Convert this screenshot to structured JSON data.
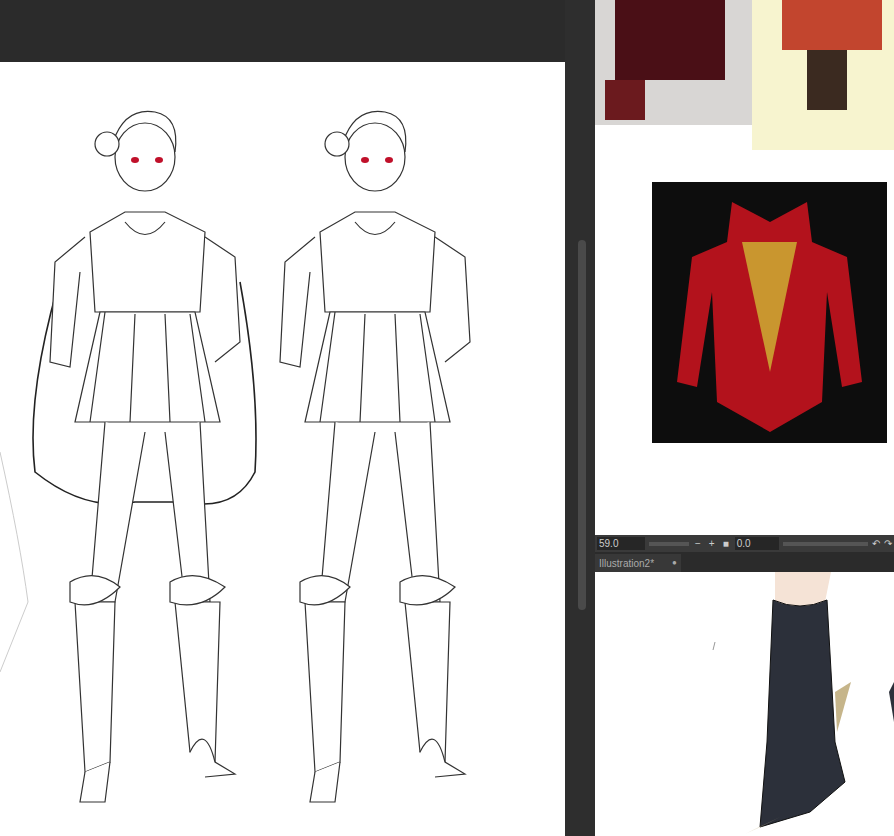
{
  "canvas": {
    "figures": [
      {
        "cape": true
      },
      {
        "cape": false
      }
    ]
  },
  "reference_toolbar": {
    "zoom": "59.0",
    "buttons": [
      "−",
      "+",
      "■"
    ],
    "rotation": "0.0",
    "history": [
      "↶",
      "↷"
    ]
  },
  "tabs": [
    {
      "label": "Illustration2*",
      "close": "●",
      "selected": true
    }
  ]
}
